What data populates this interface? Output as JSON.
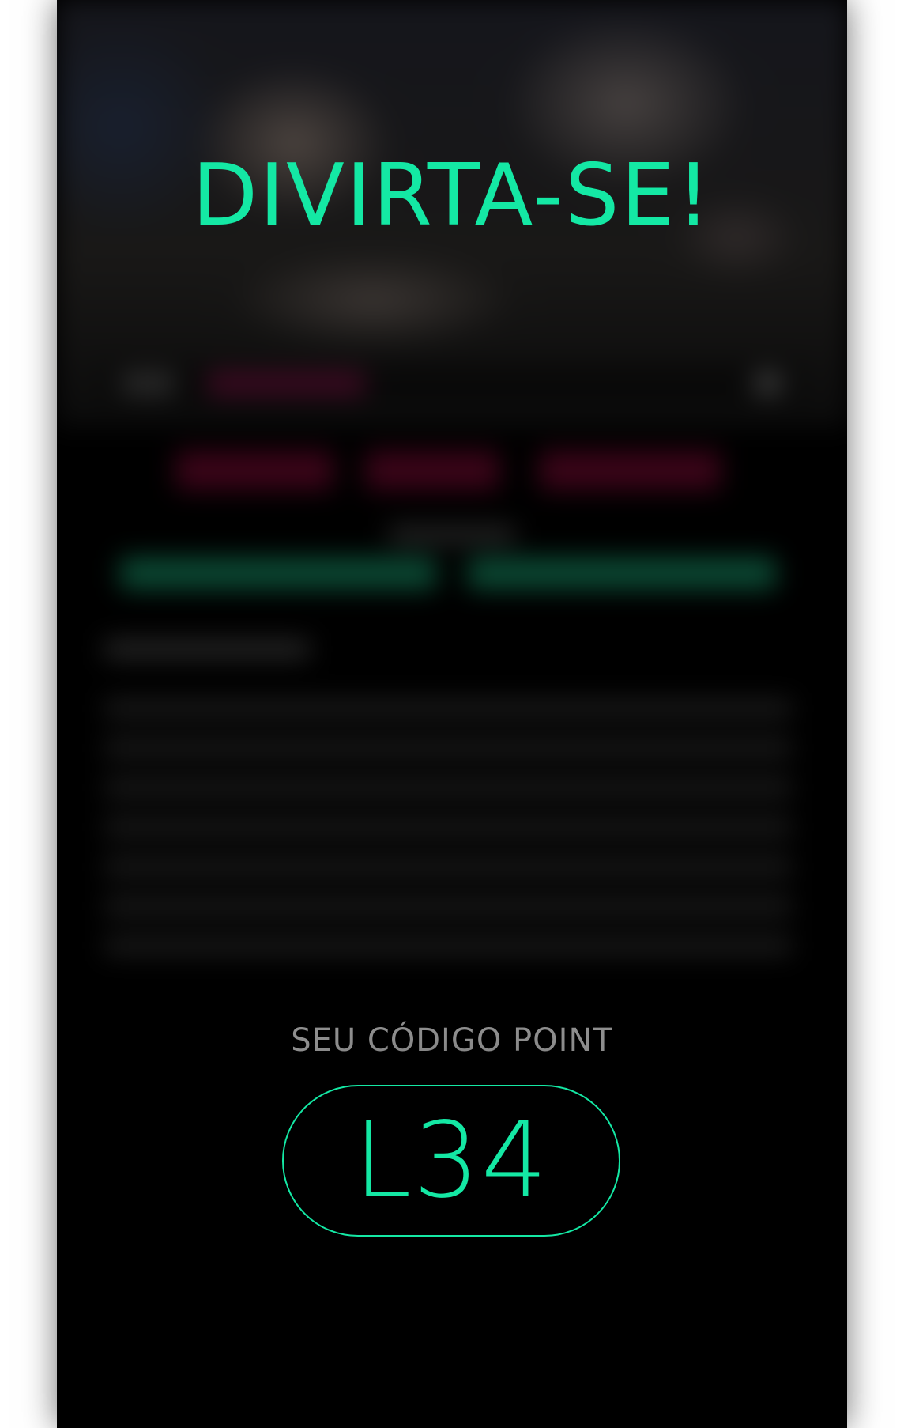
{
  "overlay": {
    "headline": "DIVIRTA-SE!",
    "code_label": "SEU CÓDIGO POINT",
    "code_value": "L34"
  },
  "colors": {
    "accent": "#14e8a4",
    "label": "#8f8f8f",
    "background": "#000000"
  }
}
